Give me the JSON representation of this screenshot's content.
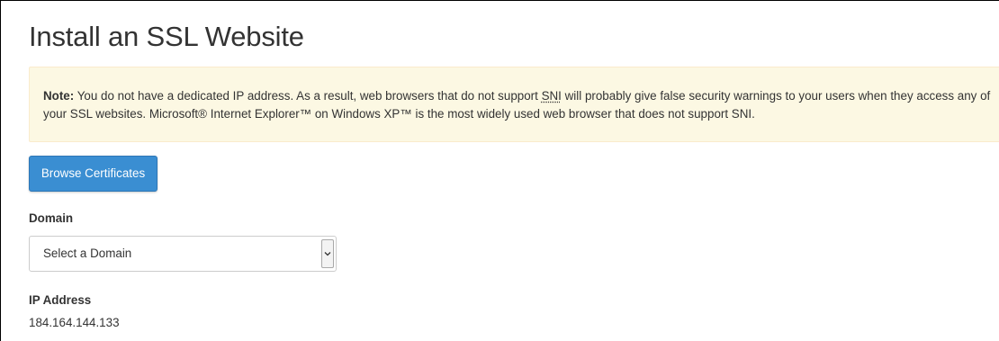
{
  "page": {
    "title": "Install an SSL Website"
  },
  "note": {
    "label": "Note:",
    "text_before_sni": " You do not have a dedicated IP address. As a result, web browsers that do not support ",
    "sni": "SNI",
    "text_after_sni": " will probably give false security warnings to your users when they access any of your SSL websites. Microsoft® Internet Explorer™ on Windows XP™ is the most widely used web browser that does not support SNI.",
    "background_color": "#fcf8e3",
    "border_color": "#faebcc"
  },
  "actions": {
    "browse_certificates_label": "Browse Certificates",
    "button_color": "#3a8ed2"
  },
  "domain": {
    "label": "Domain",
    "selected": "Select a Domain",
    "icon": "chevron-down-icon"
  },
  "ip_address": {
    "label": "IP Address",
    "value": "184.164.144.133"
  }
}
